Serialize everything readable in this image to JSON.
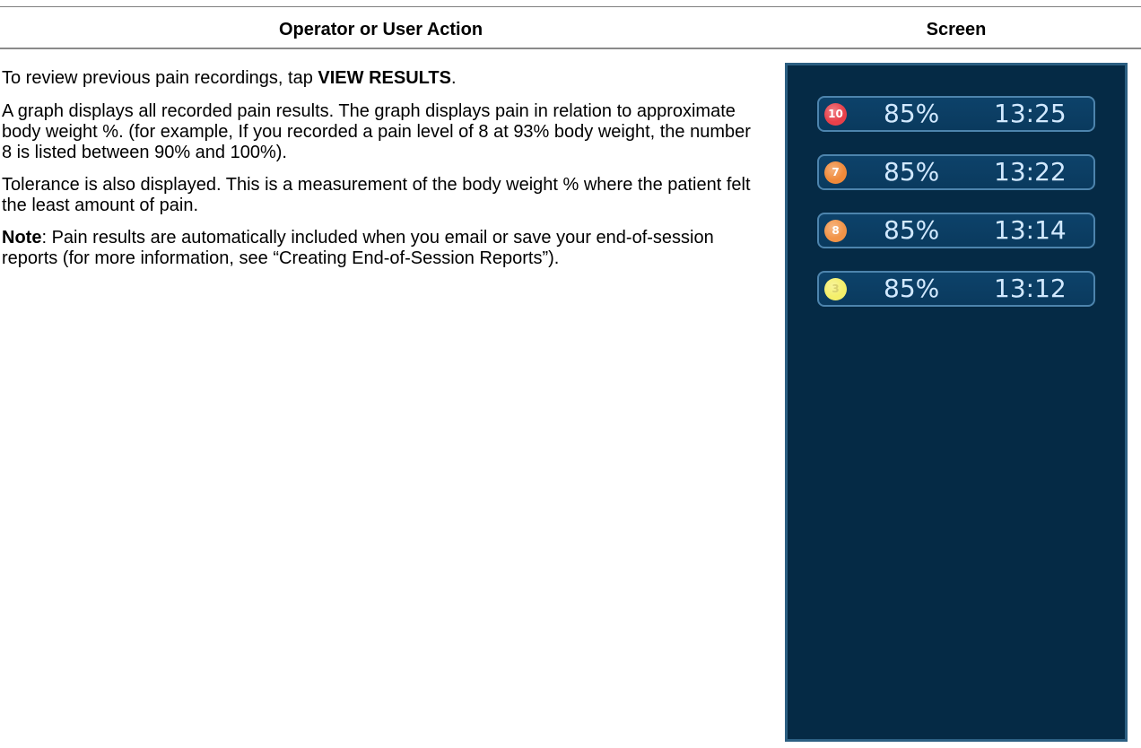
{
  "header": {
    "left": "Operator or User Action",
    "right": "Screen"
  },
  "instructions": {
    "p1_pre": "To review previous pain recordings, tap ",
    "p1_bold": "VIEW RESULTS",
    "p1_post": ".",
    "p2": "A graph displays all recorded pain results. The graph displays pain in relation to approximate body weight %. (for example, If you recorded a pain level of 8 at 93% body weight, the number 8 is listed between 90% and 100%).",
    "p3": "Tolerance is also displayed. This is a measurement of the body weight % where the patient felt the least amount of pain.",
    "p4_bold": "Note",
    "p4_rest": ": Pain results are automatically included when you email or save your end-of-session reports (for more information, see “Creating End-of-Session Reports”)."
  },
  "results": [
    {
      "level": "10",
      "percent": "85%",
      "time": "13:25",
      "color": "#e8404a"
    },
    {
      "level": "7",
      "percent": "85%",
      "time": "13:22",
      "color": "#f08a3a"
    },
    {
      "level": "8",
      "percent": "85%",
      "time": "13:14",
      "color": "#f29448"
    },
    {
      "level": "3",
      "percent": "85%",
      "time": "13:12",
      "color": "#f4ef6a"
    }
  ]
}
